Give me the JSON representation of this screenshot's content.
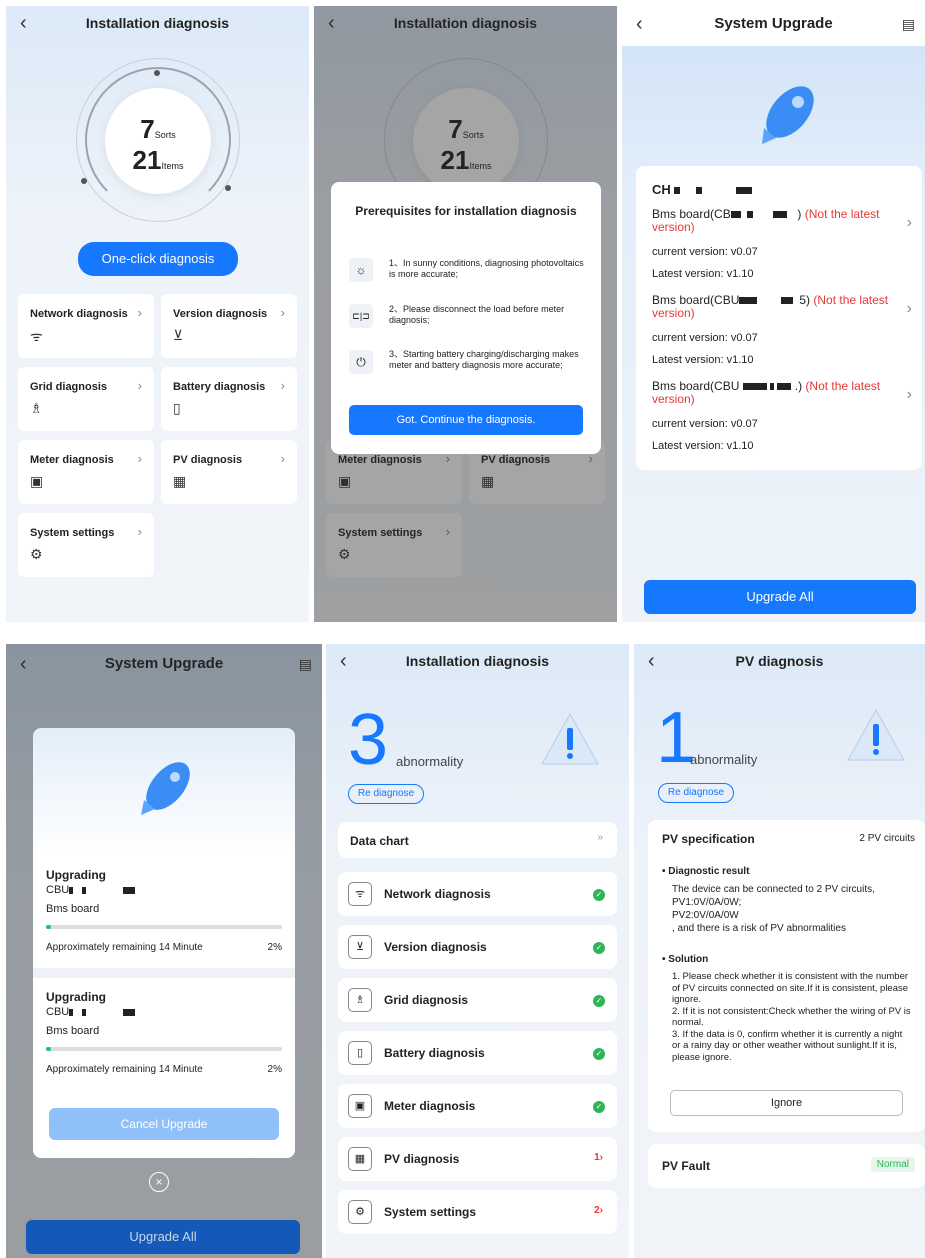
{
  "p1": {
    "title": "Installation diagnosis",
    "sorts_num": "7",
    "sorts_label": "Sorts",
    "items_num": "21",
    "items_label": "Items",
    "button": "One-click diagnosis",
    "cards": [
      "Network diagnosis",
      "Version diagnosis",
      "Grid diagnosis",
      "Battery diagnosis",
      "Meter diagnosis",
      "PV diagnosis",
      "System settings"
    ]
  },
  "p2": {
    "title": "Installation diagnosis",
    "sorts_num": "7",
    "sorts_label": "Sorts",
    "items_num": "21",
    "items_label": "Items",
    "modal_title": "Prerequisites for installation diagnosis",
    "req1": "1、In sunny conditions, diagnosing photovoltaics is more accurate;",
    "req2": "2、Please disconnect the load before meter diagnosis;",
    "req3": "3、Starting battery charging/discharging makes meter and battery diagnosis more accurate;",
    "continue": "Got. Continue the diagnosis.",
    "cards": [
      "Meter diagnosis",
      "PV diagnosis",
      "System settings"
    ]
  },
  "p3": {
    "title": "System Upgrade",
    "device": "CH",
    "boards": [
      {
        "name_a": "Bms board(CB",
        "name_b": ") ",
        "status": "(Not the latest version)",
        "current": "current version: v0.07",
        "latest": "Latest version: v1.10"
      },
      {
        "name_a": "Bms board(CBU",
        "name_b": "5) ",
        "status": "(Not the latest version)",
        "current": "current version: v0.07",
        "latest": "Latest version: v1.10"
      },
      {
        "name_a": "Bms board(CBU",
        "name_b": ".) ",
        "status": "(Not the latest version)",
        "current": "current version: v0.07",
        "latest": "Latest version: v1.10"
      }
    ],
    "button": "Upgrade All"
  },
  "p4": {
    "title": "System Upgrade",
    "items": [
      {
        "heading": "Upgrading",
        "code": "CBU",
        "board": "Bms board",
        "remain": "Approximately remaining 14 Minute",
        "pct": "2%",
        "progress": 0.02
      },
      {
        "heading": "Upgrading",
        "code": "CBU",
        "board": "Bms board",
        "remain": "Approximately remaining 14 Minute",
        "pct": "2%",
        "progress": 0.02
      }
    ],
    "cancel": "Cancel Upgrade",
    "button": "Upgrade All"
  },
  "p5": {
    "title": "Installation diagnosis",
    "count": "3",
    "count_label": "abnormality",
    "rediagnose": "Re diagnose",
    "chart": "Data chart",
    "list": [
      {
        "label": "Network diagnosis",
        "status": "ok"
      },
      {
        "label": "Version diagnosis",
        "status": "ok"
      },
      {
        "label": "Grid diagnosis",
        "status": "ok"
      },
      {
        "label": "Battery diagnosis",
        "status": "ok"
      },
      {
        "label": "Meter diagnosis",
        "status": "ok"
      },
      {
        "label": "PV diagnosis",
        "status": "1"
      },
      {
        "label": "System settings",
        "status": "2"
      }
    ]
  },
  "p6": {
    "title": "PV diagnosis",
    "count": "1",
    "count_label": "abnormality",
    "rediagnose": "Re diagnose",
    "spec": "PV specification",
    "circuits": "2 PV circuits",
    "result_h": "Diagnostic result",
    "r1": "The device can be connected to 2 PV circuits,",
    "r2": "PV1:0V/0A/0W;",
    "r3": "PV2:0V/0A/0W",
    "r4": ", and there is a risk of PV abnormalities",
    "solution_h": "Solution",
    "s1": "1. Please check whether it is consistent with the number of PV circuits connected on site.If it is consistent, please ignore.",
    "s2": "2. If it is not consistent:Check whether the wiring of PV is normal.",
    "s3": "3. If the data is 0, confirm whether it is currently a night or a rainy day or other weather without sunlight.If it is, please ignore.",
    "ignore": "Ignore",
    "fault": "PV Fault",
    "fault_status": "Normal"
  },
  "colors": {
    "accent": "#1677ff",
    "ok": "#2fb457",
    "error": "#e53935"
  }
}
